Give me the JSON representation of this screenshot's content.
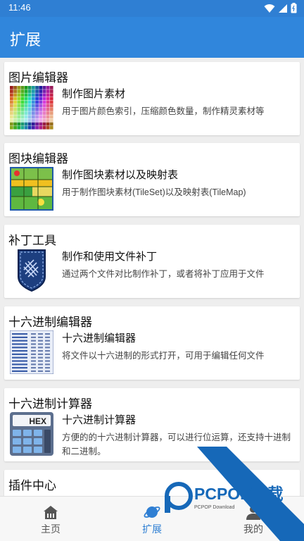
{
  "status": {
    "time": "11:46"
  },
  "appbar": {
    "title": "扩展"
  },
  "cards": [
    {
      "title": "图片编辑器",
      "name": "制作图片素材",
      "desc": "用于图片颜色索引，压缩颜色数量，制作精灵素材等",
      "icon": "palette-grid-icon"
    },
    {
      "title": "图块编辑器",
      "name": "制作图块素材以及映射表",
      "desc": "用于制作图块素材(TileSet)以及映射表(TileMap)",
      "icon": "tileset-icon"
    },
    {
      "title": "补丁工具",
      "name": "制作和使用文件补丁",
      "desc": "通过两个文件对比制作补丁，或者将补丁应用于文件",
      "icon": "patch-icon"
    },
    {
      "title": "十六进制编辑器",
      "name": "十六进制编辑器",
      "desc": "将文件以十六进制的形式打开，可用于编辑任何文件",
      "icon": "hex-dump-icon"
    },
    {
      "title": "十六进制计算器",
      "name": "十六进制计算器",
      "desc": "方便的的十六进制计算器，可以进行位运算，还支持十进制和二进制。",
      "icon": "calculator-icon",
      "hex_label": "HEX"
    },
    {
      "title": "插件中心"
    }
  ],
  "nav": [
    {
      "label": "主页",
      "icon": "home-icon"
    },
    {
      "label": "扩展",
      "icon": "planet-icon"
    },
    {
      "label": "我的",
      "icon": "person-icon"
    }
  ],
  "watermark": {
    "brand": "PCPOP下载",
    "sub": "PCPOP Download"
  },
  "colors": {
    "primary": "#3086dc",
    "status": "#2f7fd3",
    "active_nav": "#2f7fd3",
    "watermark": "#1668b8"
  }
}
